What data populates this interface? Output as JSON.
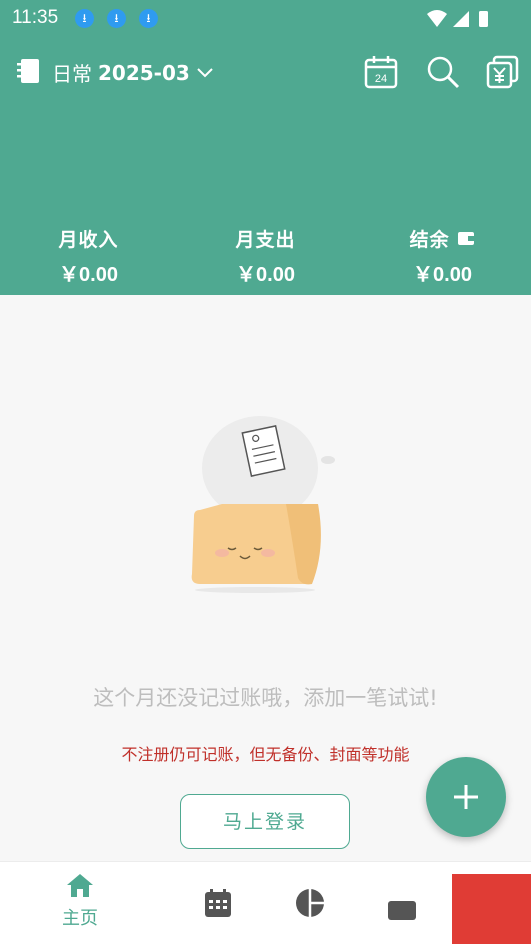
{
  "status_bar": {
    "time": "11:35",
    "download_icons": [
      "download-icon",
      "download-icon",
      "download-icon"
    ]
  },
  "toolbar": {
    "ledger_name": "日常",
    "month": "2025-03",
    "calendar_day": "24"
  },
  "summary": {
    "income_label": "月收入",
    "income_value": "￥0.00",
    "expense_label": "月支出",
    "expense_value": "￥0.00",
    "balance_label": "结余",
    "balance_value": "￥0.00"
  },
  "empty_state": {
    "message": "这个月还没记过账哦，添加一笔试试!",
    "warning": "不注册仍可记账，但无备份、封面等功能",
    "login_button": "马上登录"
  },
  "bottom_nav": {
    "home_label": "主页"
  },
  "colors": {
    "primary": "#4fa991",
    "warning": "#c0302a",
    "muted_text": "#bdbdbd"
  }
}
